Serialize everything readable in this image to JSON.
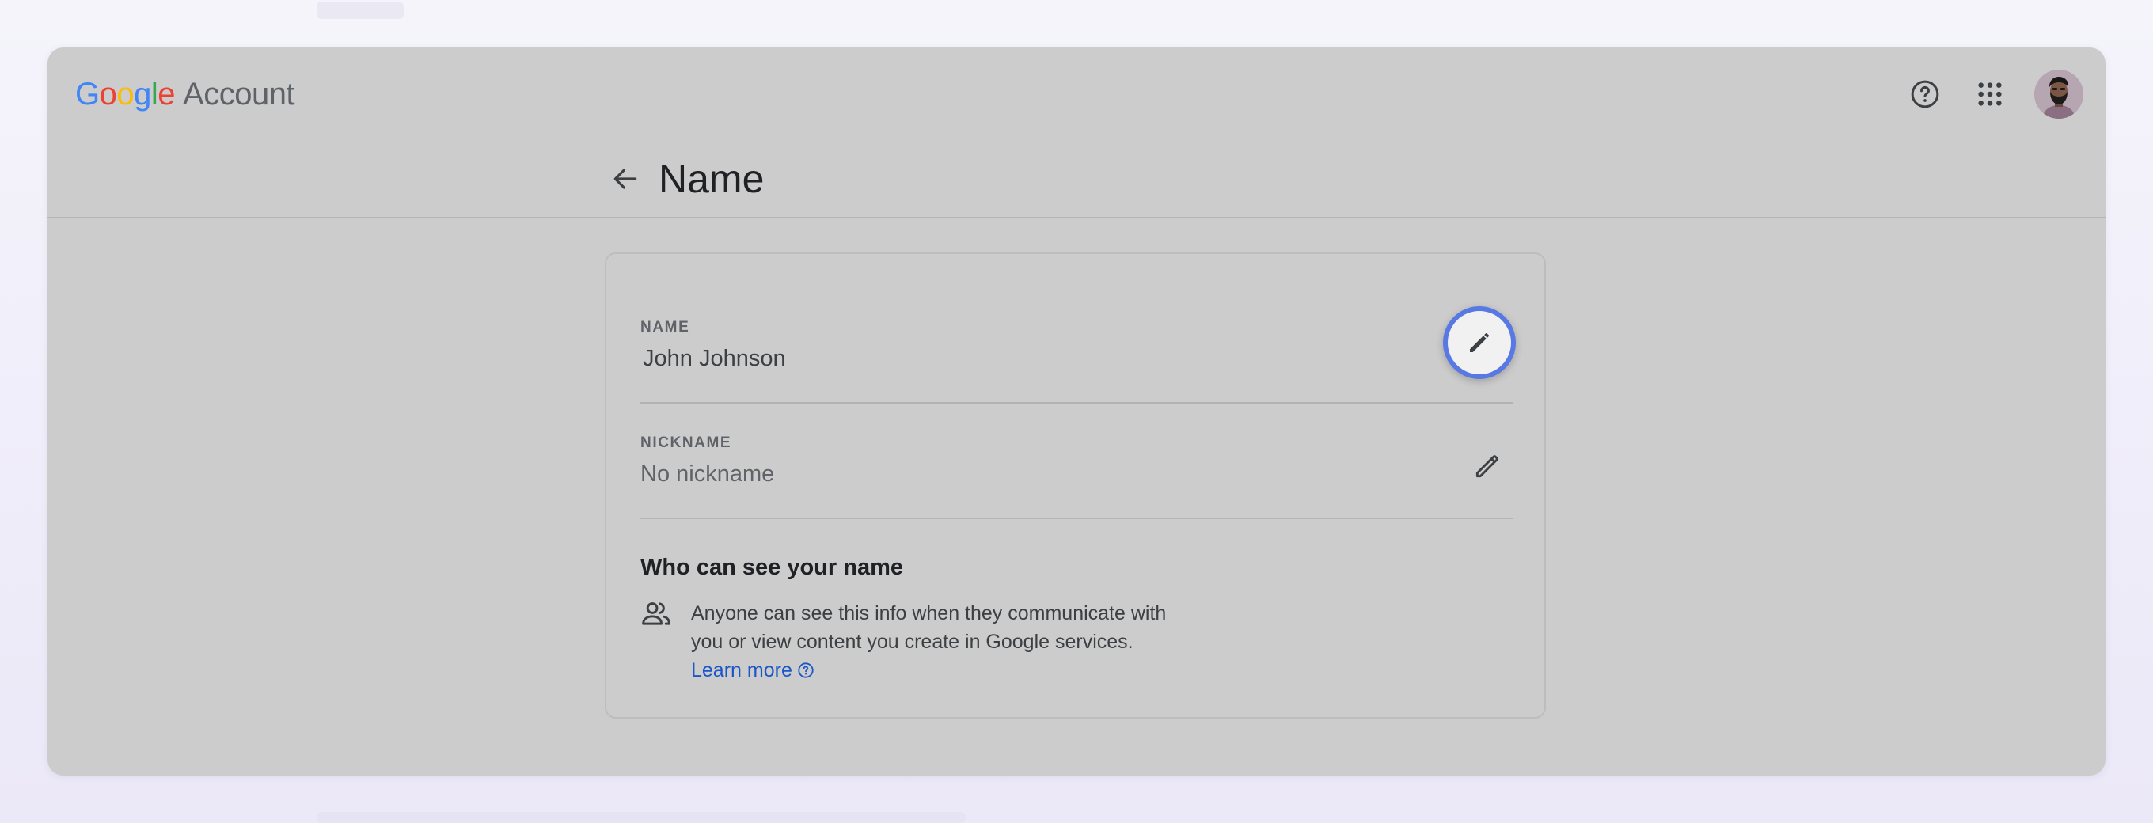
{
  "brand": {
    "google_letters": [
      "G",
      "o",
      "o",
      "g",
      "l",
      "e"
    ],
    "google_colors": [
      "#4285F4",
      "#EA4335",
      "#FBBC05",
      "#4285F4",
      "#34A853",
      "#EA4335"
    ],
    "account_label": "Account"
  },
  "header": {
    "help_icon": "help-circle-icon",
    "apps_icon": "apps-grid-icon",
    "avatar_icon": "profile-avatar"
  },
  "page": {
    "back_icon": "arrow-left-icon",
    "title": "Name"
  },
  "card": {
    "name_row": {
      "label": "NAME",
      "value": "John Johnson",
      "edit_icon": "pencil-icon",
      "edit_focused": true
    },
    "nickname_row": {
      "label": "NICKNAME",
      "value": "No nickname",
      "edit_icon": "pencil-icon"
    },
    "visibility": {
      "title": "Who can see your name",
      "icon": "people-icon",
      "description": "Anyone can see this info when they communicate with you or view content you create in Google services.",
      "link_text": "Learn more",
      "link_icon": "help-circle-icon"
    }
  },
  "colors": {
    "overlay": "#cccccc",
    "focus_ring": "#5878e4",
    "link": "#1a56c8"
  }
}
